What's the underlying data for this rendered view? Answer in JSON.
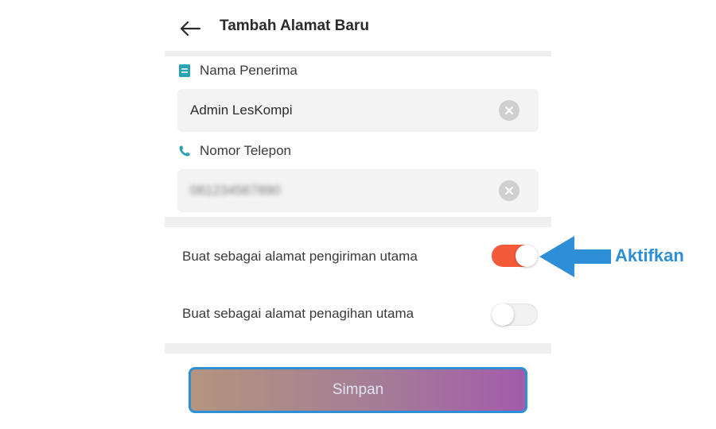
{
  "header": {
    "title": "Tambah Alamat Baru",
    "back_icon": "arrow-left-icon"
  },
  "form": {
    "recipient": {
      "label": "Nama Penerima",
      "icon": "contact-card-icon",
      "value": "Admin LesKompi"
    },
    "phone": {
      "label": "Nomor Telepon",
      "icon": "phone-icon",
      "value": "081234567890",
      "value_obscured": true
    }
  },
  "toggles": [
    {
      "label": "Buat sebagai alamat pengiriman utama",
      "checked": true
    },
    {
      "label": "Buat sebagai alamat penagihan utama",
      "checked": false
    }
  ],
  "save_button": {
    "label": "Simpan"
  },
  "annotation": {
    "text": "Aktifkan",
    "color": "#2f8fd6"
  },
  "colors": {
    "accent_icon": "#2aa3b5",
    "toggle_on": "#f35a3a",
    "highlight_border": "#2d8fd6"
  }
}
